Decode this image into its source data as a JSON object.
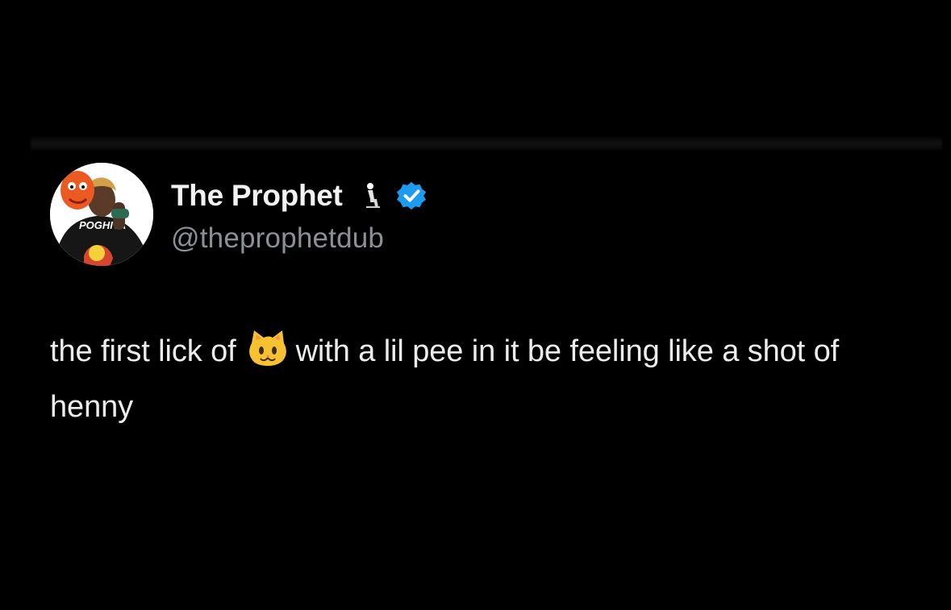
{
  "tweet": {
    "display_name": "The Prophet",
    "name_emoji": "kneeling-person-emoji",
    "verified": true,
    "handle": "@theprophetdub",
    "avatar_shirt_text": "POGHITA",
    "text_before_emoji": "the first lick of",
    "inline_emoji": "cat-face-emoji",
    "text_after_emoji": "with a lil pee in it be feeling like a shot of henny"
  },
  "colors": {
    "background": "#000000",
    "text": "#ececec",
    "handle": "#8b9096",
    "verified_badge": "#1d9bf0",
    "emoji_cat": "#f7c232"
  }
}
